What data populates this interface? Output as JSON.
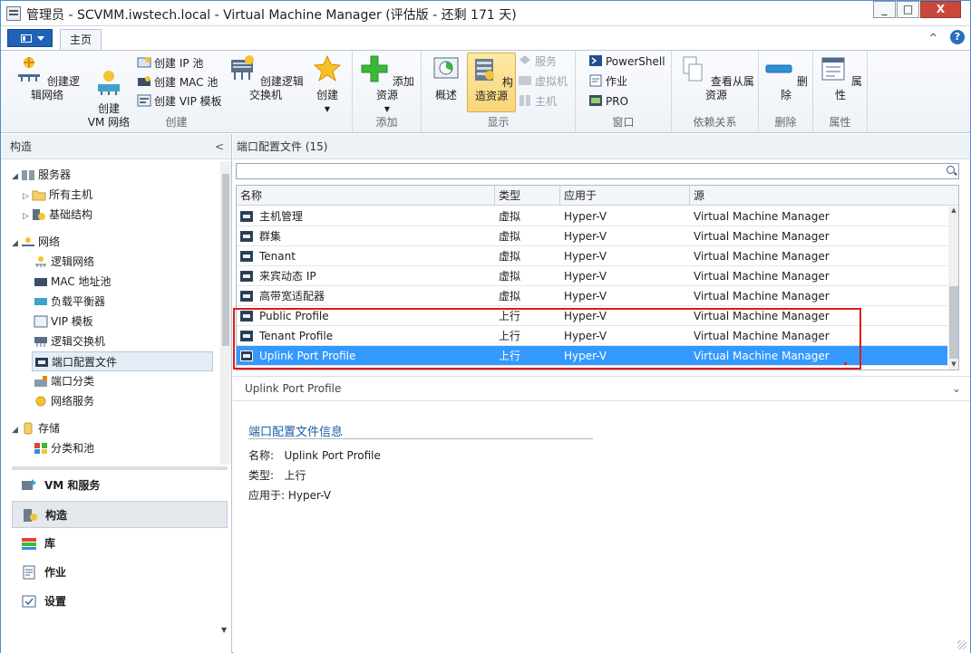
{
  "window": {
    "title": "管理员 - SCVMM.iwstech.local - Virtual Machine Manager (评估版 - 还剩 171 天)",
    "min_label": "_",
    "max_label": "□",
    "close_label": "X"
  },
  "ribbon": {
    "home_tab": "主页",
    "help_label": "?",
    "collapse_label": "^",
    "create_group": {
      "label": "创建",
      "create_logical_network": "创建逻辑网络",
      "create_vm_network": "创建\nVM 网络",
      "create_ip_pool": "创建 IP 池",
      "create_mac_pool": "创建 MAC 池",
      "create_vip_template": "创建 VIP 模板",
      "create_logical_switch": "创建逻辑交换机",
      "create": "创建"
    },
    "add_group": {
      "label": "添加",
      "add_resources": "添加资源"
    },
    "show_group": {
      "label": "显示",
      "overview": "概述",
      "fabric_resources": "构造资源",
      "services": "服务",
      "vms": "虚拟机",
      "hosts": "主机"
    },
    "window_group": {
      "label": "窗口",
      "powershell": "PowerShell",
      "jobs": "作业",
      "pro": "PRO"
    },
    "dependency_group": {
      "label": "依赖关系",
      "view_dependent": "查看从属资源"
    },
    "delete_group": {
      "label": "删除",
      "delete": "删除"
    },
    "properties_group": {
      "label": "属性",
      "properties": "属性"
    }
  },
  "left_pane": {
    "header": "构造",
    "collapse": "<",
    "tree": [
      {
        "label": "服务器",
        "level": 0,
        "expander": "◢"
      },
      {
        "label": "所有主机",
        "level": 1,
        "expander": "▷"
      },
      {
        "label": "基础结构",
        "level": 1,
        "expander": "▷"
      },
      {
        "label": "网络",
        "level": 0,
        "expander": "◢"
      },
      {
        "label": "逻辑网络",
        "level": 1,
        "expander": ""
      },
      {
        "label": "MAC 地址池",
        "level": 1,
        "expander": ""
      },
      {
        "label": "负载平衡器",
        "level": 1,
        "expander": ""
      },
      {
        "label": "VIP 模板",
        "level": 1,
        "expander": ""
      },
      {
        "label": "逻辑交换机",
        "level": 1,
        "expander": ""
      },
      {
        "label": "端口配置文件",
        "level": 1,
        "expander": "",
        "selected": true
      },
      {
        "label": "端口分类",
        "level": 1,
        "expander": ""
      },
      {
        "label": "网络服务",
        "level": 1,
        "expander": ""
      },
      {
        "label": "存储",
        "level": 0,
        "expander": "◢"
      },
      {
        "label": "分类和池",
        "level": 1,
        "expander": ""
      }
    ],
    "nav": [
      {
        "label": "VM 和服务",
        "icon": "vm-services-icon"
      },
      {
        "label": "构造",
        "icon": "fabric-icon",
        "selected": true
      },
      {
        "label": "库",
        "icon": "library-icon"
      },
      {
        "label": "作业",
        "icon": "jobs-icon"
      },
      {
        "label": "设置",
        "icon": "settings-icon"
      }
    ]
  },
  "main": {
    "header": "端口配置文件 (15)",
    "search_placeholder": "",
    "columns": [
      "名称",
      "类型",
      "应用于",
      "源"
    ],
    "rows": [
      {
        "name": "主机管理",
        "type": "虚拟",
        "applies": "Hyper-V",
        "source": "Virtual Machine Manager"
      },
      {
        "name": "群集",
        "type": "虚拟",
        "applies": "Hyper-V",
        "source": "Virtual Machine Manager"
      },
      {
        "name": "Tenant",
        "type": "虚拟",
        "applies": "Hyper-V",
        "source": "Virtual Machine Manager"
      },
      {
        "name": "来宾动态 IP",
        "type": "虚拟",
        "applies": "Hyper-V",
        "source": "Virtual Machine Manager"
      },
      {
        "name": "高带宽适配器",
        "type": "虚拟",
        "applies": "Hyper-V",
        "source": "Virtual Machine Manager"
      },
      {
        "name": "Public Profile",
        "type": "上行",
        "applies": "Hyper-V",
        "source": "Virtual Machine Manager"
      },
      {
        "name": "Tenant Profile",
        "type": "上行",
        "applies": "Hyper-V",
        "source": "Virtual Machine Manager"
      },
      {
        "name": "Uplink Port Profile",
        "type": "上行",
        "applies": "Hyper-V",
        "source": "Virtual Machine Manager",
        "selected": true
      }
    ]
  },
  "details": {
    "header": "Uplink Port Profile",
    "section_title": "端口配置文件信息",
    "name_label": "名称:",
    "name_value": "Uplink Port Profile",
    "type_label": "类型:",
    "type_value": "上行",
    "applies_label": "应用于:",
    "applies_value": "Hyper-V"
  }
}
